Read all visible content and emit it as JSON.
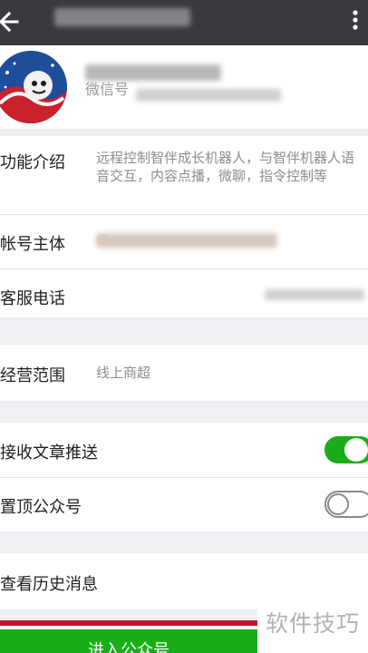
{
  "header": {
    "title": "",
    "back_icon": "back-arrow-icon",
    "menu_icon": "more-vertical-icon"
  },
  "profile": {
    "name": "",
    "wechat_label": "微信号",
    "wechat_id": ""
  },
  "rows": {
    "intro": {
      "label": "功能介绍",
      "value": "远程控制智伴成长机器人，与智伴机器人语音交互，内容点播，微聊，指令控制等"
    },
    "subject": {
      "label": "帐号主体",
      "value": ""
    },
    "service_phone": {
      "label": "客服电话",
      "value": ""
    },
    "business_scope": {
      "label": "经营范围",
      "value": "线上商超"
    },
    "receive_articles": {
      "label": "接收文章推送",
      "enabled": true
    },
    "pin_top": {
      "label": "置顶公众号",
      "enabled": false
    },
    "history": {
      "label": "查看历史消息"
    }
  },
  "button": {
    "enter_label": "进入公众号"
  },
  "watermark": {
    "text": "软件技巧"
  },
  "colors": {
    "header": "#393a3f",
    "accent_green": "#1aad19",
    "background": "#efeff4"
  }
}
